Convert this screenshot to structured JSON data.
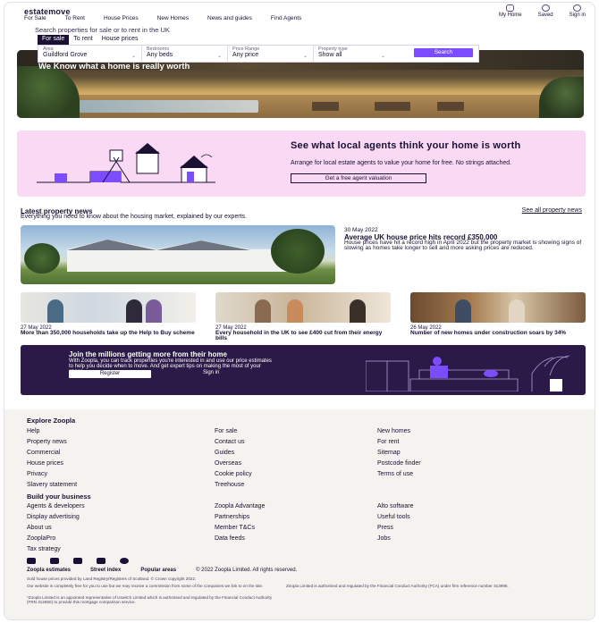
{
  "header": {
    "logo": "estatemove",
    "nav": [
      "For Sale",
      "To Rent",
      "House Prices",
      "New Homes",
      "News and guides",
      "Find Agents"
    ],
    "user_nav": [
      {
        "label": "My Home",
        "icon": "home-icon"
      },
      {
        "label": "Saved",
        "icon": "heart-icon"
      },
      {
        "label": "Sign in",
        "icon": "user-icon"
      }
    ]
  },
  "search": {
    "label": "Search properties for sale or to rent in the UK",
    "tabs": [
      "For sale",
      "To rent",
      "House prices"
    ],
    "fields": [
      {
        "label": "Area",
        "value": "Guildford Grove"
      },
      {
        "label": "Bedrooms",
        "value": "Any beds"
      },
      {
        "label": "Price Range",
        "value": "Any price"
      },
      {
        "label": "Property type",
        "value": "Show all"
      }
    ],
    "button": "Search"
  },
  "hero": {
    "title": "We Know what a home is really worth"
  },
  "valuation": {
    "title": "See what local agents think your home is worth",
    "subtitle": "Arrange for local estate agents to value your home for free. No strings attached.",
    "button": "Get a free agent valuation"
  },
  "news": {
    "heading": "Latest property news",
    "subheading": "Everything you need to know about the housing market, explained by our experts.",
    "see_all": "See all property news",
    "feature": {
      "date": "30 May 2022",
      "title": "Average UK house price hits record £350,000",
      "desc": "House prices have hit a record high in April 2022 but the property market is showing signs of slowing as homes take longer to sell and more asking prices are reduced."
    },
    "cards": [
      {
        "date": "27 May 2022",
        "title": "More than 350,000 households take up the Help to Buy scheme"
      },
      {
        "date": "27 May 2022",
        "title": "Every household in the UK to see £400 cut from their energy bills"
      },
      {
        "date": "26 May 2022",
        "title": "Number of new homes under construction soars by 34%"
      }
    ]
  },
  "join": {
    "title": "Join the millions getting more from their home",
    "subtitle": "With Zoopla, you can track properties you're interested in and use our price estimates to help you decide when to move. And get expert tips on making the most of your space.",
    "register": "Register",
    "sign_in": "Sign in"
  },
  "footer": {
    "explore_heading": "Explore Zoopla",
    "explore_cols": [
      [
        "Help",
        "Property news",
        "Commercial",
        "House prices",
        "Privacy",
        "Slavery statement"
      ],
      [
        "For sale",
        "Contact us",
        "Guides",
        "Overseas",
        "Cookie policy",
        "Treehouse"
      ],
      [
        "New homes",
        "For rent",
        "Sitemap",
        "Postcode finder",
        "Terms of use"
      ]
    ],
    "business_heading": "Build your business",
    "business_cols": [
      [
        "Agents & developers",
        "Display advertising",
        "About us",
        "ZooplaPro",
        "Tax strategy"
      ],
      [
        "Zoopla Advantage",
        "Partnerships",
        "Member T&Cs",
        "Data feeds"
      ],
      [
        "Alto software",
        "Useful tools",
        "Press",
        "Jobs"
      ]
    ],
    "social": [
      "facebook-icon",
      "twitter-icon",
      "linkedin-icon",
      "youtube-icon",
      "instagram-icon"
    ],
    "bottom_links": [
      "Zoopla estimates",
      "Street index",
      "Popular areas"
    ],
    "copyright": "© 2022 Zoopla Limited. All rights reserved.",
    "legal1": "Sold house prices provided by Land Registry/Registers of Scotland. © Crown copyright 2022.",
    "legal2": "Our website is completely free for you to use but we may receive a commission from some of the companies we link to on the site.",
    "legal3": "Zoopla Limited is authorised and regulated by the Financial Conduct Authority (FCA) under firm reference number 313995.",
    "legal4": "*Zoopla Limited is an appointed representative of Uswitch Limited which is authorised and regulated by the Financial Conduct Authority (FRN 312850) to provide this mortgage comparison service."
  }
}
